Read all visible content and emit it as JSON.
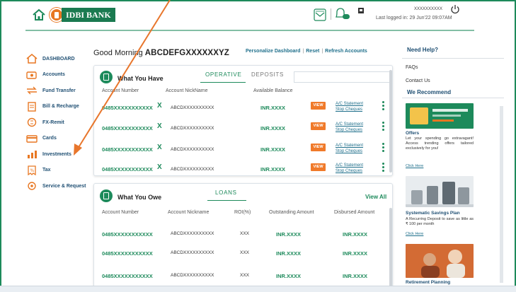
{
  "header": {
    "bank_name": "IDBI BANK",
    "username": "XXXXXXXXXX",
    "last_login": "Last logged in:  29 Jun'22 09:07AM"
  },
  "greeting": {
    "prefix": "Good Morning",
    "name": "ABCDEFGXXXXXXYZ"
  },
  "quick_links": [
    "Personalize Dashboard",
    "Reset",
    "Refresh Accounts"
  ],
  "sidebar": {
    "items": [
      {
        "label": "DASHBOARD",
        "icon": "home-icon"
      },
      {
        "label": "Accounts",
        "icon": "accounts-icon"
      },
      {
        "label": "Fund Transfer",
        "icon": "fund-transfer-icon"
      },
      {
        "label": "Bill & Recharge",
        "icon": "bill-icon"
      },
      {
        "label": "FX-Remit",
        "icon": "fx-remit-icon"
      },
      {
        "label": "Cards",
        "icon": "cards-icon"
      },
      {
        "label": "Investments",
        "icon": "investments-icon"
      },
      {
        "label": "Tax",
        "icon": "tax-icon"
      },
      {
        "label": "Service & Request",
        "icon": "service-icon"
      }
    ]
  },
  "have": {
    "title": "What You Have",
    "tabs": [
      "OPERATIVE",
      "DEPOSITS"
    ],
    "columns": [
      "Account Number",
      "Account NickName",
      "Available Balance"
    ],
    "rows": [
      {
        "account": "0485XXXXXXXXXXX",
        "x": "X",
        "nickname": "ABCDXXXXXXXXXX",
        "balance": "INR.XXXX",
        "view": "VIEW",
        "link1": "A/C Statement",
        "link2": "Stop Cheques"
      },
      {
        "account": "0485XXXXXXXXXXX",
        "x": "X",
        "nickname": "ABCDXXXXXXXXXX",
        "balance": "INR.XXXX",
        "view": "VIEW",
        "link1": "A/C Statement",
        "link2": "Stop Cheques"
      },
      {
        "account": "0485XXXXXXXXXXX",
        "x": "X",
        "nickname": "ABCDXXXXXXXXXX",
        "balance": "INR.XXXX",
        "view": "VIEW",
        "link1": "A/C Statement",
        "link2": "Stop Cheques"
      },
      {
        "account": "0485XXXXXXXXXXX",
        "x": "X",
        "nickname": "ABCDXXXXXXXXXX",
        "balance": "INR.XXXX",
        "view": "VIEW",
        "link1": "A/C Statement",
        "link2": "Stop Cheques"
      }
    ]
  },
  "owe": {
    "title": "What You Owe",
    "tab": "LOANS",
    "view_all": "View All",
    "columns": [
      "Account Number",
      "Account Nickname",
      "ROI(%)",
      "Outstanding Amount",
      "Disbursed Amount"
    ],
    "rows": [
      {
        "account": "0485XXXXXXXXXXX",
        "nickname": "ABCDXXXXXXXXXX",
        "roi": "XXX",
        "outstanding": "INR.XXXX",
        "disbursed": "INR.XXXX"
      },
      {
        "account": "0485XXXXXXXXXXX",
        "nickname": "ABCDXXXXXXXXXX",
        "roi": "XXX",
        "outstanding": "INR.XXXX",
        "disbursed": "INR.XXXX"
      },
      {
        "account": "0485XXXXXXXXXXX",
        "nickname": "ABCDXXXXXXXXXX",
        "roi": "XXX",
        "outstanding": "INR.XXXX",
        "disbursed": "INR.XXXX"
      }
    ]
  },
  "right_panel": {
    "need_help": "Need Help?",
    "faqs": "FAQs",
    "contact": "Contact Us",
    "recommend": "We Recommend",
    "promos": [
      {
        "title": "Offers",
        "text": "Let your spending go extravagant! Access trending offers tailored exclusively for you!",
        "link": "Click Here"
      },
      {
        "title": "Systematic Savings Plan",
        "text": "A Recurring Deposit to save as little as ₹ 100 per month",
        "link": "Click Here"
      },
      {
        "title": "Retirement Planning",
        "text": "",
        "link": ""
      }
    ]
  },
  "colors": {
    "brand_green": "#1d8a5b",
    "brand_orange": "#e87722",
    "link_blue": "#1f6f8b",
    "annotation_arrow": "#e8762c"
  }
}
